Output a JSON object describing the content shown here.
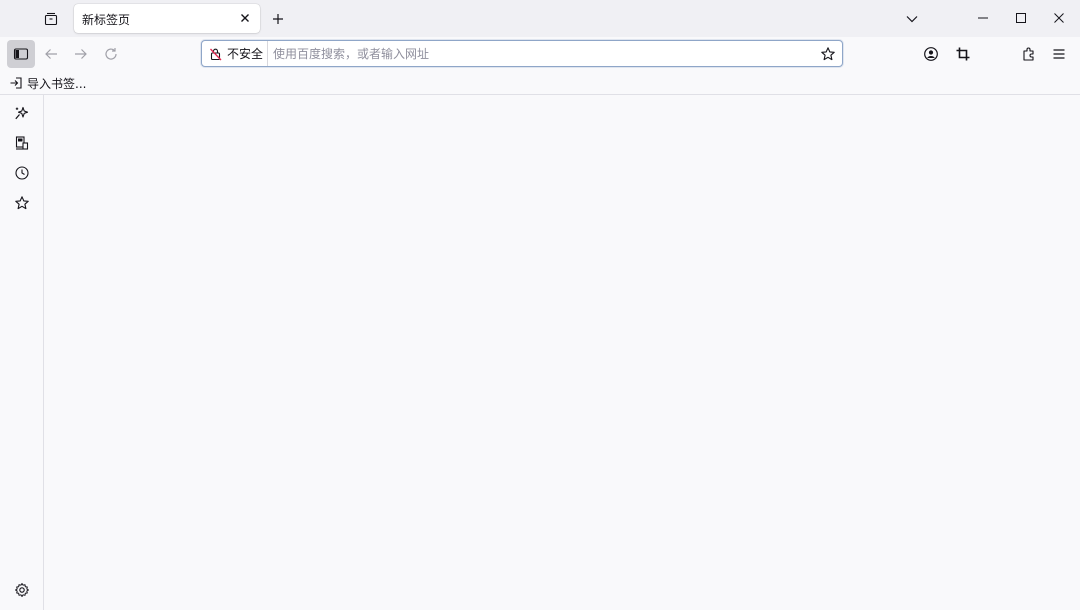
{
  "tabs": [
    {
      "title": "新标签页",
      "active": true
    }
  ],
  "tabbar": {
    "tab_overview_icon": "tab-overview-icon",
    "new_tab_icon": "plus-icon",
    "list_all_tabs_icon": "chevron-down-icon"
  },
  "window_controls": [
    "minimize-icon",
    "maximize-icon",
    "close-icon"
  ],
  "navbar": {
    "buttons": [
      "sidebar-toggle-icon",
      "back-arrow-icon",
      "forward-arrow-icon",
      "reload-icon"
    ],
    "security_label": "不安全",
    "url_placeholder": "使用百度搜索，或者输入网址",
    "url_value": "",
    "right_buttons": [
      "account-icon",
      "crop-icon",
      "extensions-icon",
      "menu-icon"
    ]
  },
  "bookmarks_bar": {
    "items": [
      {
        "label": "导入书签...",
        "icon": "import-icon"
      }
    ]
  },
  "sidebar": {
    "items": [
      "ai-chatbot-icon",
      "synced-tabs-icon",
      "history-icon",
      "bookmarks-icon"
    ],
    "settings_icon": "gear-icon"
  },
  "colors": {
    "tabbar_bg": "#f0f0f4",
    "toolbar_bg": "#f9f9fb",
    "active_button_bg": "#cfcfd4",
    "urlbar_border": "#8fa6c8",
    "insecure_lock": "#e22850"
  }
}
